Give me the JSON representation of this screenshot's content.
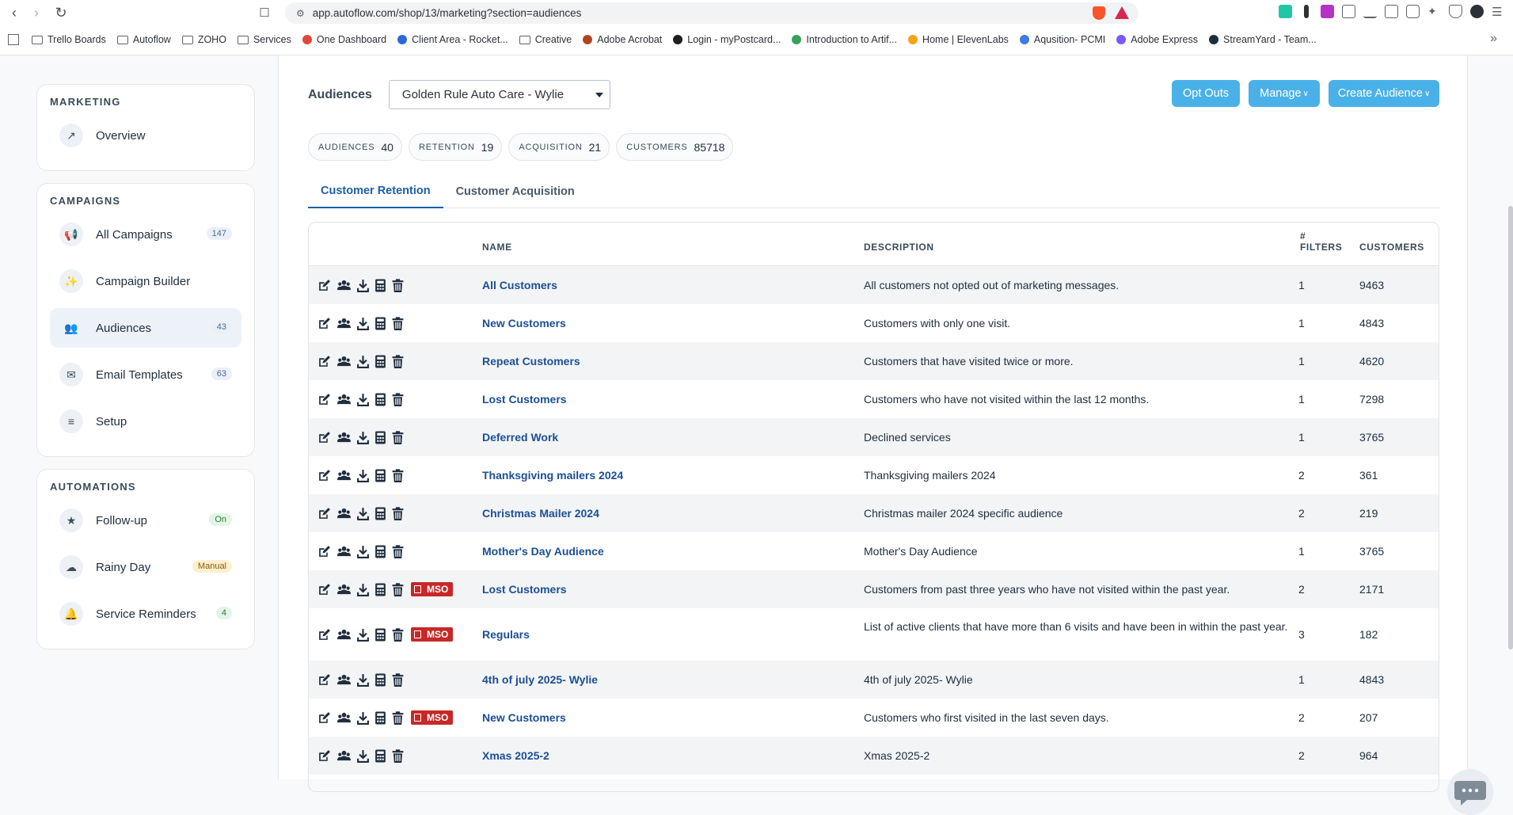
{
  "browser": {
    "url": "app.autoflow.com/shop/13/marketing?section=audiences",
    "bookmarks": [
      {
        "label": "Trello Boards",
        "type": "folder"
      },
      {
        "label": "Autoflow",
        "type": "folder"
      },
      {
        "label": "ZOHO",
        "type": "folder"
      },
      {
        "label": "Services",
        "type": "folder"
      },
      {
        "label": "One Dashboard",
        "type": "site"
      },
      {
        "label": "Client Area - Rocket...",
        "type": "site"
      },
      {
        "label": "Creative",
        "type": "folder"
      },
      {
        "label": "Adobe Acrobat",
        "type": "site"
      },
      {
        "label": "Login - myPostcard...",
        "type": "site"
      },
      {
        "label": "Introduction to Artif...",
        "type": "site"
      },
      {
        "label": "Home | ElevenLabs",
        "type": "site"
      },
      {
        "label": "Aqusition- PCMI",
        "type": "site"
      },
      {
        "label": "Adobe Express",
        "type": "site"
      },
      {
        "label": "StreamYard - Team...",
        "type": "site"
      }
    ],
    "more": "»"
  },
  "sidebar": {
    "marketing": {
      "heading": "MARKETING",
      "items": [
        {
          "label": "Overview",
          "icon": "chart-line-icon"
        }
      ]
    },
    "campaigns": {
      "heading": "CAMPAIGNS",
      "items": [
        {
          "label": "All Campaigns",
          "icon": "megaphone-icon",
          "badge": "147"
        },
        {
          "label": "Campaign Builder",
          "icon": "magic-wand-icon",
          "badge": ""
        },
        {
          "label": "Audiences",
          "icon": "users-icon",
          "badge": "43"
        },
        {
          "label": "Email Templates",
          "icon": "envelope-icon",
          "badge": "63"
        },
        {
          "label": "Setup",
          "icon": "sliders-icon",
          "badge": ""
        }
      ]
    },
    "automations": {
      "heading": "AUTOMATIONS",
      "items": [
        {
          "label": "Follow-up",
          "icon": "star-icon",
          "badge": "On"
        },
        {
          "label": "Rainy Day",
          "icon": "rain-cloud-icon",
          "badge": "Manual"
        },
        {
          "label": "Service Reminders",
          "icon": "bell-icon",
          "badge": "4"
        }
      ]
    }
  },
  "main": {
    "title": "Audiences",
    "shop_select": "Golden Rule Auto Care - Wylie",
    "buttons": {
      "opt_outs": "Opt Outs",
      "manage": "Manage",
      "create": "Create Audience"
    },
    "stats": [
      {
        "label": "AUDIENCES",
        "value": "40"
      },
      {
        "label": "RETENTION",
        "value": "19"
      },
      {
        "label": "ACQUISITION",
        "value": "21"
      },
      {
        "label": "CUSTOMERS",
        "value": "85718"
      }
    ],
    "tabs": [
      {
        "label": "Customer Retention",
        "active": true
      },
      {
        "label": "Customer Acquisition",
        "active": false
      }
    ],
    "table": {
      "headers": {
        "name": "NAME",
        "description": "DESCRIPTION",
        "filters_line1": "#",
        "filters_line2": "FILTERS",
        "customers": "CUSTOMERS"
      },
      "mso_label": "MSO",
      "rows": [
        {
          "name": "All Customers",
          "description": "All customers not opted out of marketing messages.",
          "filters": "1",
          "customers": "9463",
          "mso": false
        },
        {
          "name": "New Customers",
          "description": "Customers with only one visit.",
          "filters": "1",
          "customers": "4843",
          "mso": false
        },
        {
          "name": "Repeat Customers",
          "description": "Customers that have visited twice or more.",
          "filters": "1",
          "customers": "4620",
          "mso": false
        },
        {
          "name": "Lost Customers",
          "description": "Customers who have not visited within the last 12 months.",
          "filters": "1",
          "customers": "7298",
          "mso": false
        },
        {
          "name": "Deferred Work",
          "description": "Declined services",
          "filters": "1",
          "customers": "3765",
          "mso": false
        },
        {
          "name": "Thanksgiving mailers 2024",
          "description": "Thanksgiving mailers 2024",
          "filters": "2",
          "customers": "361",
          "mso": false
        },
        {
          "name": "Christmas Mailer 2024",
          "description": "Christmas mailer 2024 specific audience",
          "filters": "2",
          "customers": "219",
          "mso": false
        },
        {
          "name": "Mother's Day Audience",
          "description": "Mother's Day Audience",
          "filters": "1",
          "customers": "3765",
          "mso": false
        },
        {
          "name": "Lost Customers",
          "description": "Customers from past three years who have not visited within the past year.",
          "filters": "2",
          "customers": "2171",
          "mso": true
        },
        {
          "name": "Regulars",
          "description": "List of active clients that have more than 6 visits and have been in within the past year.",
          "filters": "3",
          "customers": "182",
          "mso": true
        },
        {
          "name": "4th of july 2025- Wylie",
          "description": "4th of july 2025- Wylie",
          "filters": "1",
          "customers": "4843",
          "mso": false
        },
        {
          "name": "New Customers",
          "description": "Customers who first visited in the last seven days.",
          "filters": "2",
          "customers": "207",
          "mso": true
        },
        {
          "name": "Xmas 2025-2",
          "description": "Xmas 2025-2",
          "filters": "2",
          "customers": "964",
          "mso": false
        }
      ]
    }
  },
  "colors": {
    "accent": "#4ab1e8",
    "link": "#1b4f96",
    "mso": "#c72828"
  }
}
